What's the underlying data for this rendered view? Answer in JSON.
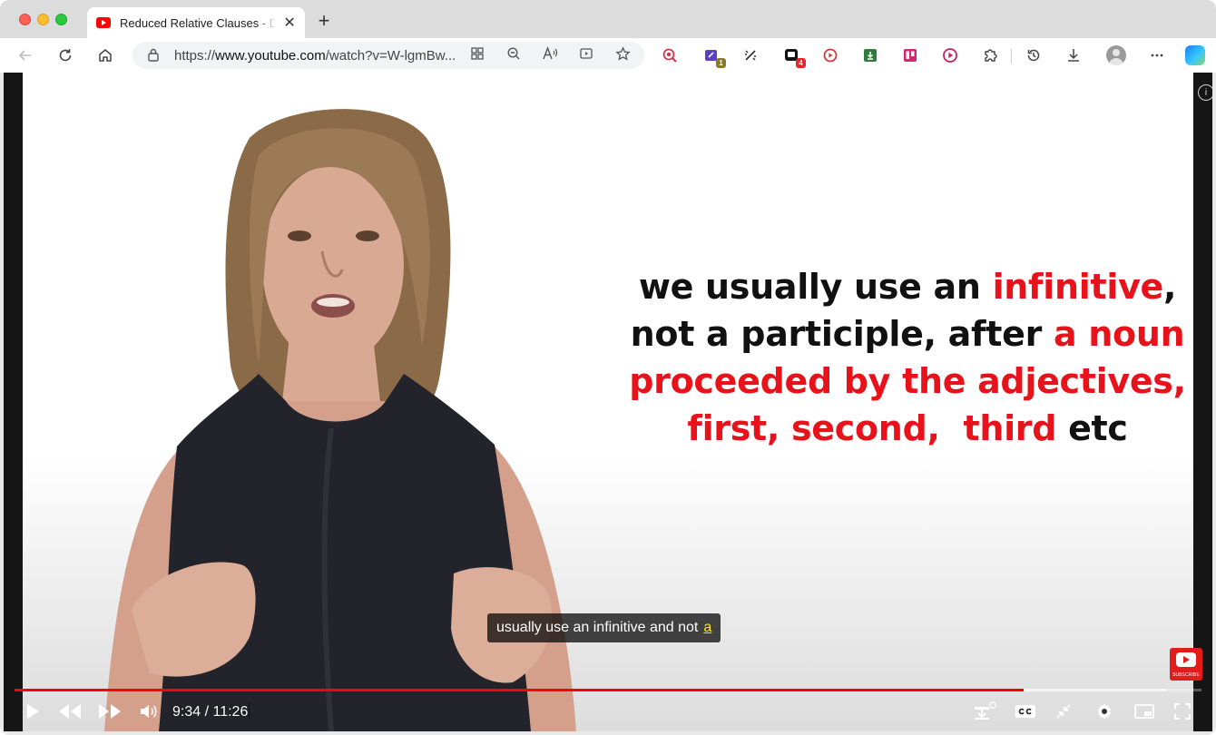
{
  "browser": {
    "tab": {
      "title": "Reduced Relative Clauses - Define",
      "favicon": "youtube-icon"
    },
    "address_bar": {
      "url_prefix": "https://",
      "url_host": "www.youtube.com",
      "url_path": "/watch?v=W-lgmBw..."
    },
    "extensions": [
      {
        "name": "magnifier-extension-icon",
        "color": "#d4344b"
      },
      {
        "name": "edit-extension-icon",
        "color": "#5b3fc4",
        "badge": "1",
        "badge_color": "#8a7a2a"
      },
      {
        "name": "sparkle-extension-icon",
        "color": "#333333"
      },
      {
        "name": "chat-extension-icon",
        "color": "#111111",
        "badge": "4",
        "badge_color": "#e0282d"
      },
      {
        "name": "record-extension-icon",
        "color": "#d23b3b"
      },
      {
        "name": "download-extension-icon",
        "color": "#2e7d3f"
      },
      {
        "name": "trello-extension-icon",
        "color": "#d4276f"
      },
      {
        "name": "play-extension-icon",
        "color": "#c81e63"
      }
    ]
  },
  "video": {
    "lesson_text": {
      "line1_black": "we usually use an ",
      "line1_red": "infinitive",
      "line1_end": ",",
      "line2_black": "not a participle, after ",
      "line2_red": "a noun",
      "line3_red": "proceeded by the adjectives,",
      "line4_red": "first, second,  third",
      "line4_black": " etc"
    },
    "caption": {
      "text": "usually use an infinitive and not",
      "highlight": "a"
    },
    "subscribe_label": "SUBSCRIBE",
    "info_label": "i"
  },
  "player": {
    "current_time": "9:34",
    "separator": " / ",
    "duration": "11:26",
    "progress": 0.85,
    "buffered": 0.9704,
    "colors": {
      "progress": "#ff0000",
      "lesson_red": "#e8121b"
    }
  }
}
